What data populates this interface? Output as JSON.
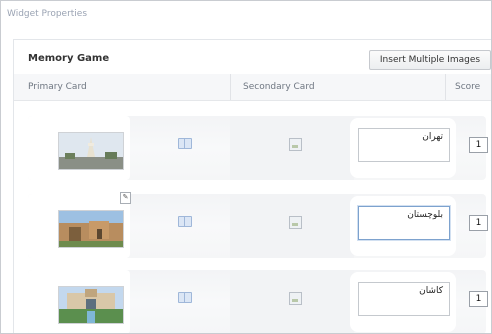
{
  "window": {
    "title": "Widget Properties"
  },
  "panel": {
    "title": "Memory Game",
    "insert_button": "Insert Multiple Images"
  },
  "columns": {
    "primary": "Primary Card",
    "secondary": "Secondary Card",
    "score": "Score"
  },
  "rows": [
    {
      "text": "تهران",
      "score": "1",
      "image": "tower-photo"
    },
    {
      "text": "بلوچستان",
      "score": "1",
      "image": "building-photo"
    },
    {
      "text": "کاشان",
      "score": "1",
      "image": "garden-photo"
    }
  ],
  "icons": [
    "edit-icon",
    "card-icon",
    "image-placeholder-icon"
  ]
}
